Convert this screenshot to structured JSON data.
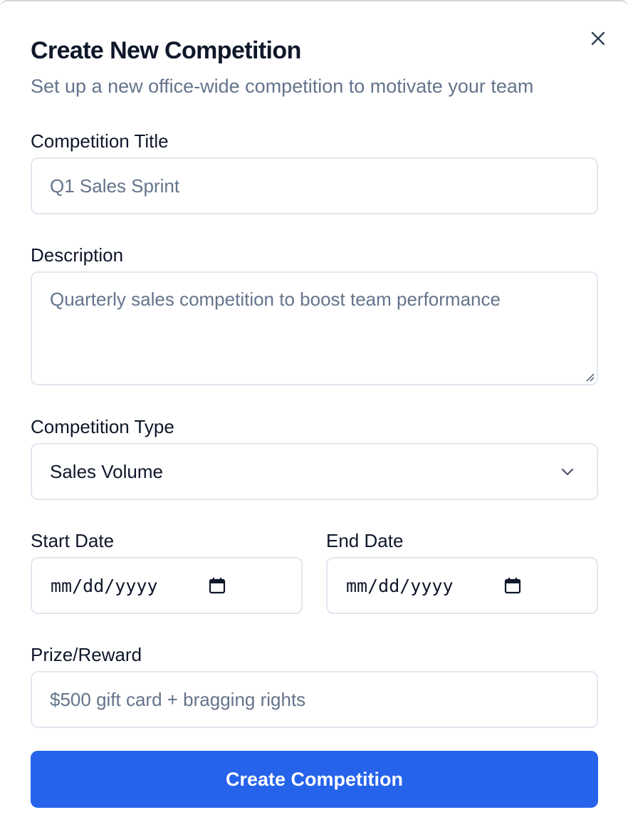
{
  "dialog": {
    "title": "Create New Competition",
    "subtitle": "Set up a new office-wide competition to motivate your team",
    "close_icon": "close-icon"
  },
  "form": {
    "title_label": "Competition Title",
    "title_placeholder": "Q1 Sales Sprint",
    "description_label": "Description",
    "description_placeholder": "Quarterly sales competition to boost team performance",
    "type_label": "Competition Type",
    "type_value": "Sales Volume",
    "start_label": "Start Date",
    "start_placeholder": "mm/dd/yyyy",
    "end_label": "End Date",
    "end_placeholder": "mm/dd/yyyy",
    "prize_label": "Prize/Reward",
    "prize_placeholder": "$500 gift card + bragging rights",
    "submit_label": "Create Competition"
  },
  "colors": {
    "accent": "#2563eb",
    "text": "#0f172a",
    "muted": "#64748b",
    "border": "#e2e8f0"
  }
}
